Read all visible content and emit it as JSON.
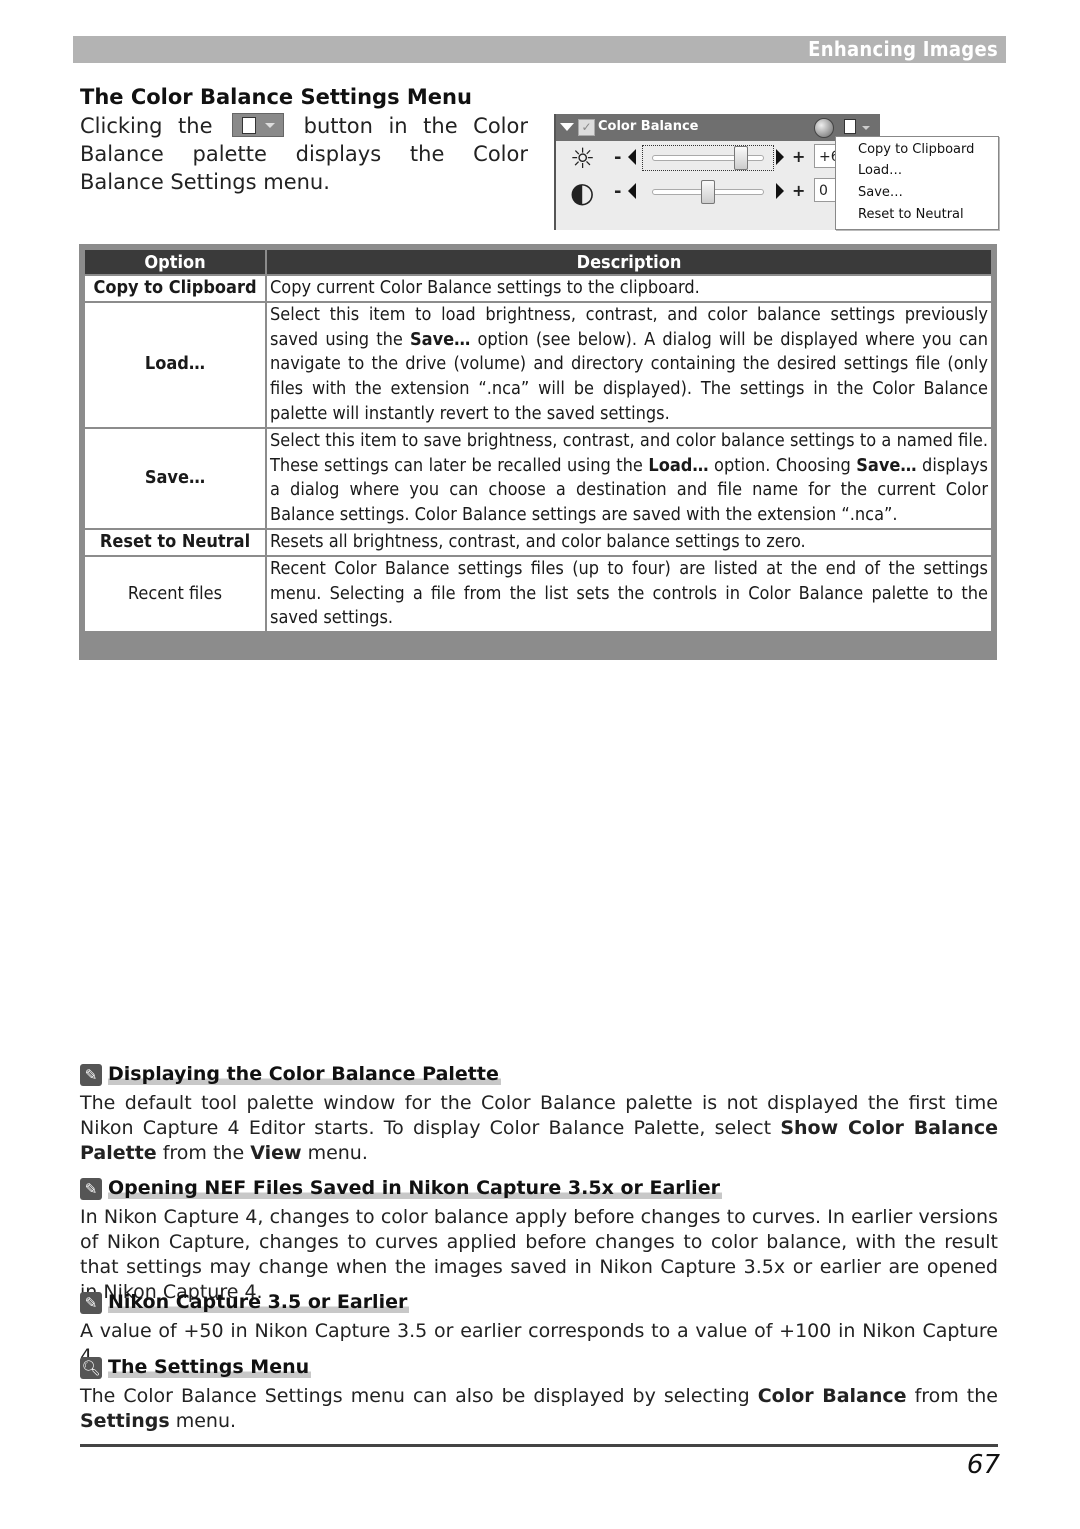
{
  "header": {
    "title": "Enhancing Images",
    "bar_color": "#b3b3b3"
  },
  "section": {
    "title": "The Color Balance Settings Menu",
    "intro_before": "Clicking the",
    "intro_button_icon": "settings-menu-button-icon",
    "intro_after": "button in the Color Balance palette displays the Color Balance Settings menu."
  },
  "palette": {
    "title": "Color Balance",
    "brightness_value": "+6",
    "contrast_value": "0",
    "brightness_level_percent": 80,
    "contrast_level_percent": 50,
    "menu_items": [
      "Copy to Clipboard",
      "Load…",
      "Save…",
      "Reset to Neutral"
    ]
  },
  "table": {
    "headers": [
      "Option",
      "Description"
    ],
    "rows": [
      {
        "option": "Copy to Clipboard",
        "description": "Copy current Color Balance settings to the clipboard."
      },
      {
        "option": "Load…",
        "description_html": "Select this item to load brightness, contrast, and color balance settings previously saved using the <b>Save…</b> option (see below). A dialog will be displayed where you can navigate to the drive (volume) and directory containing the desired settings file (only files with the extension “.nca” will be displayed). The settings in the Color Balance palette will instantly revert to the saved settings."
      },
      {
        "option": "Save…",
        "description_html": "Select this item to save brightness, contrast, and color balance settings to a named file. These settings can later be recalled using the <b>Load…</b> option. Choosing <b>Save…</b> displays a dialog where you can choose a destination and file name for the current Color Balance settings. Color Balance settings are saved with the extension “.nca”."
      },
      {
        "option": "Reset to Neutral",
        "description": "Resets all brightness, contrast, and color balance settings to zero."
      },
      {
        "option": "Recent files",
        "description": "Recent Color Balance settings files (up to four) are listed at the end of the settings menu. Selecting a file from the list sets the controls in Color Balance palette to the saved settings."
      }
    ]
  },
  "notes": [
    {
      "icon": "pencil-note-icon",
      "title": "Displaying the Color Balance Palette",
      "body_html": "The default tool palette window for the Color Balance palette is not displayed the first time Nikon Capture 4 Editor starts. To display Color Balance Palette, select <b>Show Color Balance Palette</b> from the <b>View</b> menu."
    },
    {
      "icon": "pencil-note-icon",
      "title": "Opening NEF Files Saved in Nikon Capture 3.5x or Earlier",
      "body_html": "In Nikon Capture 4, changes to color balance apply before changes to curves. In earlier versions of Nikon Capture, changes to curves applied before changes to color balance, with the result that settings may change when the images saved in Nikon Capture 3.5x or earlier are opened in Nikon Capture 4."
    },
    {
      "icon": "pencil-note-icon",
      "title": "Nikon Capture 3.5 or Earlier",
      "body_html": "A value of +50 in Nikon Capture 3.5 or earlier corresponds to a value of +100 in Nikon Capture 4."
    },
    {
      "icon": "magnifier-note-icon",
      "title": "The Settings Menu",
      "body_html": "The Color Balance Settings menu can also be displayed by selecting <b>Color Balance</b> from the <b>Settings</b> menu."
    }
  ],
  "footer": {
    "page_number": "67"
  }
}
